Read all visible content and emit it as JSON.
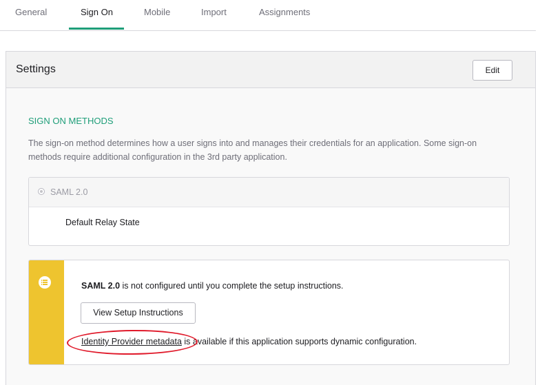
{
  "tabs": [
    {
      "label": "General"
    },
    {
      "label": "Sign On"
    },
    {
      "label": "Mobile"
    },
    {
      "label": "Import"
    },
    {
      "label": "Assignments"
    }
  ],
  "settings": {
    "title": "Settings",
    "edit_label": "Edit"
  },
  "sign_on_methods": {
    "heading": "SIGN ON METHODS",
    "description": "The sign-on method determines how a user signs into and manages their credentials for an application. Some sign-on methods require additional configuration in the 3rd party application."
  },
  "saml": {
    "option_label": "SAML 2.0",
    "relay_state_label": "Default Relay State"
  },
  "notice": {
    "bold_text": "SAML 2.0",
    "message": " is not configured until you complete the setup instructions.",
    "button_label": "View Setup Instructions",
    "link_text": "Identity Provider metadata",
    "link_suffix": " is available if this application supports dynamic configuration.",
    "accent_color": "#eec42f"
  },
  "colors": {
    "active_tab_underline": "#1f9e79",
    "section_heading": "#1f9e79",
    "highlight_annotation": "#e0192a"
  }
}
